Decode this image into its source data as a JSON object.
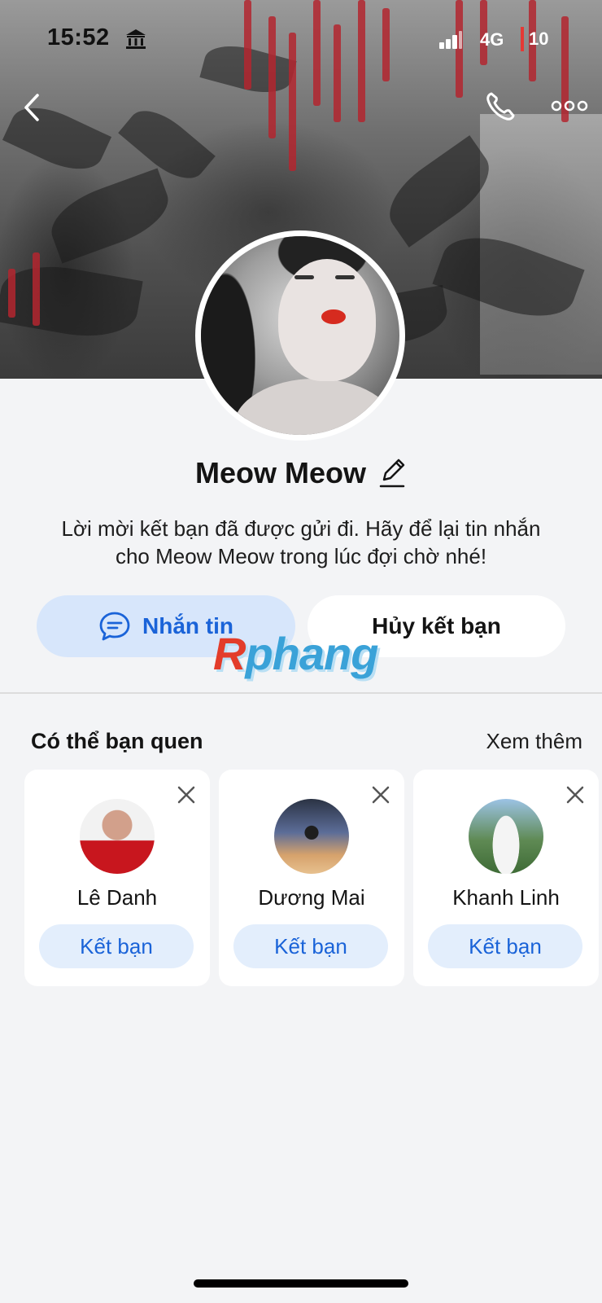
{
  "status_bar": {
    "time": "15:52",
    "network": "4G",
    "battery": "10"
  },
  "profile": {
    "name": "Meow Meow",
    "message_line1": "Lời mời kết bạn đã được gửi đi. Hãy để lại tin nhắn",
    "message_line2": "cho Meow Meow trong lúc đợi chờ nhé!"
  },
  "actions": {
    "message_label": "Nhắn tin",
    "cancel_label": "Hủy kết bạn"
  },
  "watermark": {
    "first": "R",
    "rest": "phang"
  },
  "suggestions": {
    "title": "Có thể bạn quen",
    "see_more": "Xem thêm",
    "people": [
      {
        "name": "Lê Danh",
        "button": "Kết bạn"
      },
      {
        "name": "Dương Mai",
        "button": "Kết bạn"
      },
      {
        "name": "Khanh Linh",
        "button": "Kết bạn"
      }
    ]
  },
  "colors": {
    "accent": "#1a63d8",
    "accent_bg": "#d7e6fb",
    "background": "#f3f4f6",
    "battery_low": "#e53935"
  },
  "icons": [
    "bank-icon",
    "signal-icon",
    "back-icon",
    "phone-icon",
    "more-icon",
    "edit-icon",
    "chat-icon",
    "close-icon"
  ]
}
